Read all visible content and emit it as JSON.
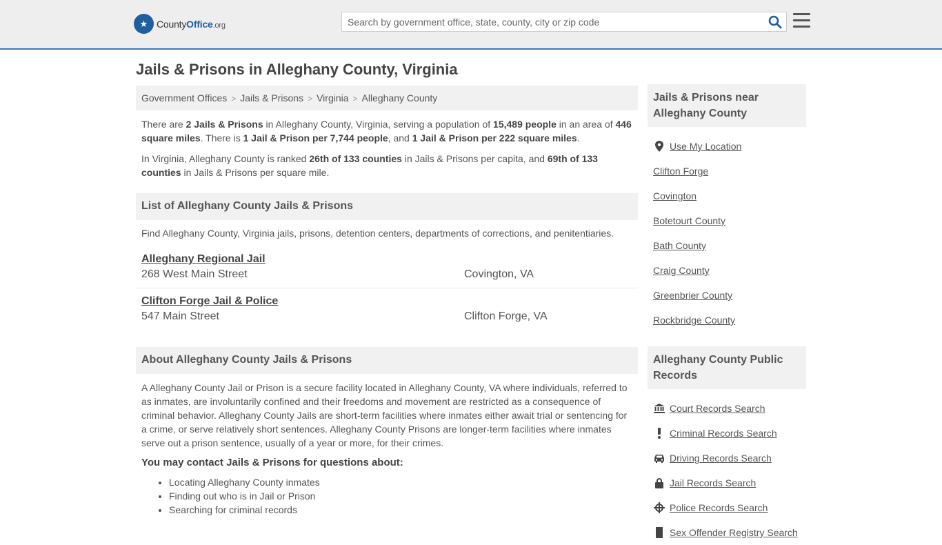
{
  "header": {
    "logo_main": "County",
    "logo_bold": "Office",
    "logo_suffix": ".org",
    "search_placeholder": "Search by government office, state, county, city or zip code"
  },
  "page_title": "Jails & Prisons in Alleghany County, Virginia",
  "breadcrumb": [
    "Government Offices",
    "Jails & Prisons",
    "Virginia",
    "Alleghany County"
  ],
  "intro": {
    "p1": {
      "a": "There are ",
      "b": "2 Jails & Prisons",
      "c": " in Alleghany County, Virginia, serving a population of ",
      "d": "15,489 people",
      "e": " in an area of ",
      "f": "446 square miles",
      "g": ". There is ",
      "h": "1 Jail & Prison per 7,744 people",
      "i": ", and ",
      "j": "1 Jail & Prison per 222 square miles",
      "k": "."
    },
    "p2": {
      "a": "In Virginia, Alleghany County is ranked ",
      "b": "26th of 133 counties",
      "c": " in Jails & Prisons per capita, and ",
      "d": "69th of 133 counties",
      "e": " in Jails & Prisons per square mile."
    }
  },
  "list_section": {
    "title": "List of Alleghany County Jails & Prisons",
    "subtitle": "Find Alleghany County, Virginia jails, prisons, detention centers, departments of corrections, and penitentiaries.",
    "items": [
      {
        "name": "Alleghany Regional Jail",
        "address": "268 West Main Street",
        "city": "Covington, VA"
      },
      {
        "name": "Clifton Forge Jail & Police",
        "address": "547 Main Street",
        "city": "Clifton Forge, VA"
      }
    ]
  },
  "about_section": {
    "title": "About Alleghany County Jails & Prisons",
    "paragraph": "A Alleghany County Jail or Prison is a secure facility located in Alleghany County, VA where individuals, referred to as inmates, are involuntarily confined and their freedoms and movement are restricted as a consequence of criminal behavior. Alleghany County Jails are short-term facilities where inmates either await trial or sentencing for a crime, or serve relatively short sentences. Alleghany County Prisons are longer-term facilities where inmates serve out a prison sentence, usually of a year or more, for their crimes.",
    "contact_title": "You may contact Jails & Prisons for questions about:",
    "bullets": [
      "Locating Alleghany County inmates",
      "Finding out who is in Jail or Prison",
      "Searching for criminal records"
    ]
  },
  "sidebar": {
    "nearby_title": "Jails & Prisons near Alleghany County",
    "nearby": [
      "Use My Location",
      "Clifton Forge",
      "Covington",
      "Botetourt County",
      "Bath County",
      "Craig County",
      "Greenbrier County",
      "Rockbridge County"
    ],
    "records_title": "Alleghany County Public Records",
    "records": [
      "Court Records Search",
      "Criminal Records Search",
      "Driving Records Search",
      "Jail Records Search",
      "Police Records Search",
      "Sex Offender Registry Search"
    ]
  },
  "colors": {
    "accent": "#3a79b6",
    "logo_blue": "#1f5f9f",
    "panel": "#f1f1f1"
  },
  "icons": [
    "search-icon",
    "menu-icon",
    "location-pin-icon",
    "courthouse-icon",
    "exclamation-icon",
    "car-icon",
    "lock-icon",
    "crosshair-icon"
  ]
}
